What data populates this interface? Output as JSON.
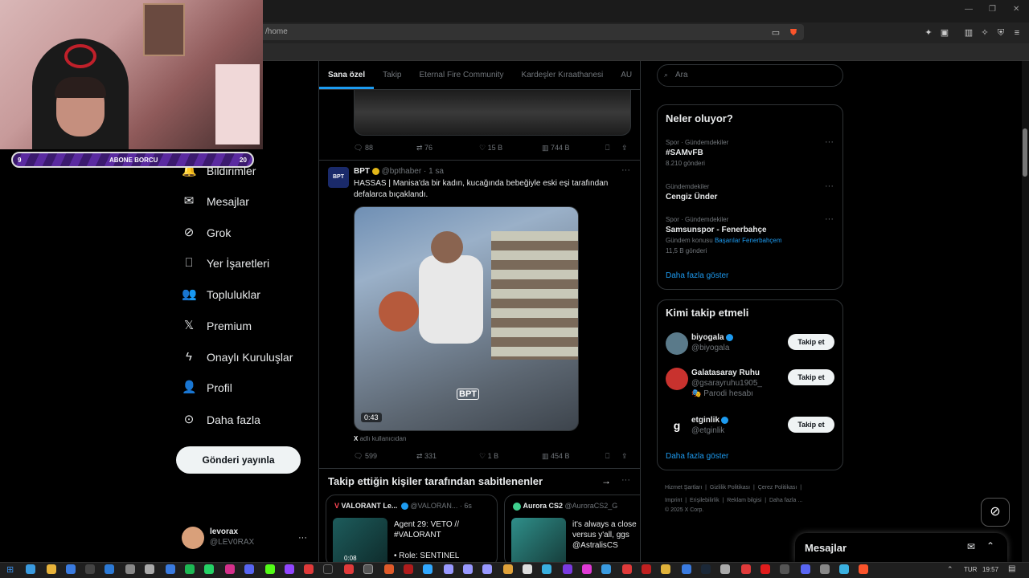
{
  "browser": {
    "url": "/home"
  },
  "webcam": {
    "sub_bar": {
      "left": "9",
      "label": "ABONE BORCU",
      "right": "20"
    }
  },
  "nav": {
    "items": [
      {
        "label": "Bildirimler",
        "icon": "bell-icon"
      },
      {
        "label": "Mesajlar",
        "icon": "mail-icon"
      },
      {
        "label": "Grok",
        "icon": "grok-icon"
      },
      {
        "label": "Yer İşaretleri",
        "icon": "bookmark-icon"
      },
      {
        "label": "Topluluklar",
        "icon": "people-icon"
      },
      {
        "label": "Premium",
        "icon": "x-logo-icon"
      },
      {
        "label": "Onaylı Kuruluşlar",
        "icon": "lightning-icon"
      },
      {
        "label": "Profil",
        "icon": "person-icon"
      },
      {
        "label": "Daha fazla",
        "icon": "more-circle-icon"
      }
    ],
    "post_button": "Gönderi yayınla",
    "user": {
      "name": "levorax",
      "handle": "@LEV0RAX"
    }
  },
  "tabs": [
    "Sana özel",
    "Takip",
    "Eternal Fire Community",
    "Kardeşler Kıraathanesi",
    "AU"
  ],
  "tweet1": {
    "replies": "88",
    "reposts": "76",
    "likes": "15 B",
    "views": "744 B"
  },
  "tweet2": {
    "name": "BPT",
    "handle": "@bpthaber",
    "time": "· 1 sa",
    "text": "HASSAS | Manisa'da bir kadın, kucağında bebeğiyle eski eşi tarafından defalarca bıçaklandı.",
    "duration": "0:43",
    "watermark": "BPT",
    "source_x": "X",
    "source_text": "adlı kullanıcıdan",
    "replies": "599",
    "reposts": "331",
    "likes": "1 B",
    "views": "454 B"
  },
  "pinned": {
    "title": "Takip ettiğin kişiler tarafından sabitlenenler",
    "cards": [
      {
        "name": "VALORANT Le...",
        "handle": "@VALORAN...",
        "time": "· 6s",
        "line1": "Agent 29: VETO //",
        "line2": "#VALORANT",
        "line3": "• Role: SENTINEL",
        "thumb_time": "0:08"
      },
      {
        "name": "Aurora CS2",
        "handle": "@AuroraCS2_G",
        "line1": "it's always a close",
        "line2": "versus y'all, ggs",
        "line3": "@AstralisCS"
      }
    ]
  },
  "search": {
    "placeholder": "Ara"
  },
  "trends": {
    "title": "Neler oluyor?",
    "items": [
      {
        "context": "Spor · Gündemdekiler",
        "name": "#SAMvFB",
        "count": "8.210 gönderi"
      },
      {
        "context": "Gündemdekiler",
        "name": "Cengiz Ünder",
        "count": ""
      },
      {
        "context": "Spor · Gündemdekiler",
        "name": "Samsunspor - Fenerbahçe",
        "topic_label": "Gündem konusu",
        "topic_link": "Başarılar Fenerbahçem",
        "count": "11,5 B gönderi"
      }
    ],
    "show_more": "Daha fazla göster"
  },
  "who_to_follow": {
    "title": "Kimi takip etmeli",
    "users": [
      {
        "name": "biyogala",
        "handle": "@biyogala",
        "note": "",
        "verified": true
      },
      {
        "name": "Galatasaray Ruhu",
        "handle": "@gsarayruhu1905_",
        "note": "Parodi hesabı",
        "verified": false
      },
      {
        "name": "etginlik",
        "handle": "@etginlik",
        "note": "",
        "verified": true
      }
    ],
    "follow_label": "Takip et",
    "show_more": "Daha fazla göster"
  },
  "footer": {
    "links": [
      "Hizmet Şartları",
      "Gizlilik Politikası",
      "Çerez Politikası",
      "Imprint",
      "Erişilebilirlik",
      "Reklam bilgisi",
      "Daha fazla ..."
    ],
    "copyright": "© 2025 X Corp."
  },
  "messages_dock": {
    "label": "Mesajlar"
  },
  "taskbar": {
    "lang": "TUR",
    "time": "19:57"
  },
  "colors": {
    "accent": "#1d9bf0",
    "bg": "#000000",
    "border": "#2f3336"
  }
}
